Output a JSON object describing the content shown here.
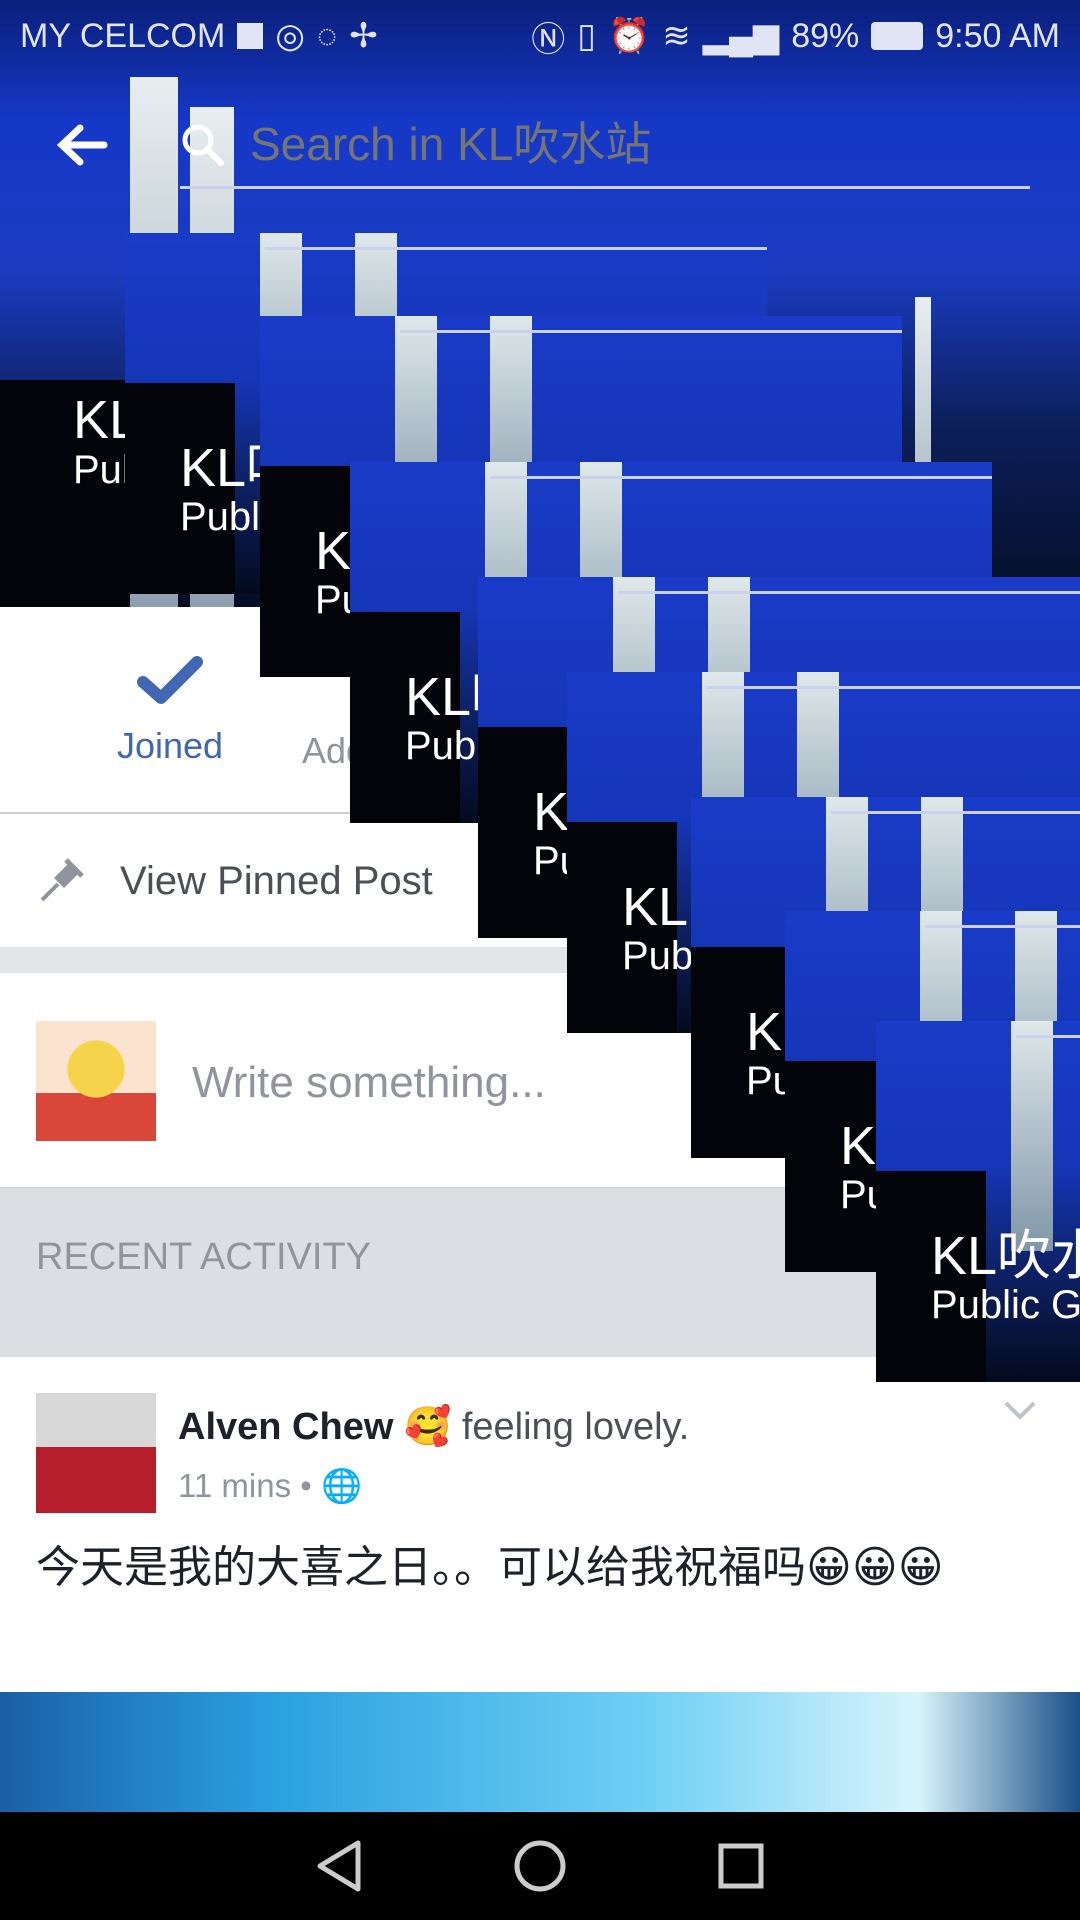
{
  "status_bar": {
    "carrier": "MY CELCOM",
    "battery": "89%",
    "time": "9:50 AM",
    "icons": [
      "facebook-icon",
      "chrome-icon",
      "whatsapp-icon",
      "pinwheel-icon",
      "nfc-icon",
      "vibrate-icon",
      "alarm-icon",
      "wifi-icon",
      "signal-icon",
      "battery-icon"
    ]
  },
  "search": {
    "placeholder": "Search in KL吹水站"
  },
  "group": {
    "name": "KL吹水站",
    "privacy": "Public Group"
  },
  "actions": {
    "joined": "Joined",
    "add": "Add Members"
  },
  "pinned": {
    "label": "View Pinned Post"
  },
  "composer": {
    "placeholder": "Write something..."
  },
  "recent": {
    "header": "RECENT ACTIVITY"
  },
  "post": {
    "author": "Alven Chew",
    "feeling": "feeling lovely.",
    "time": "11 mins",
    "dot": "•",
    "body": "今天是我的大喜之日。。可以给我祝福吗😀😀😀",
    "emoji": "🥰"
  },
  "colors": {
    "fb_blue": "#4267b2",
    "gray_text": "#90949c"
  }
}
